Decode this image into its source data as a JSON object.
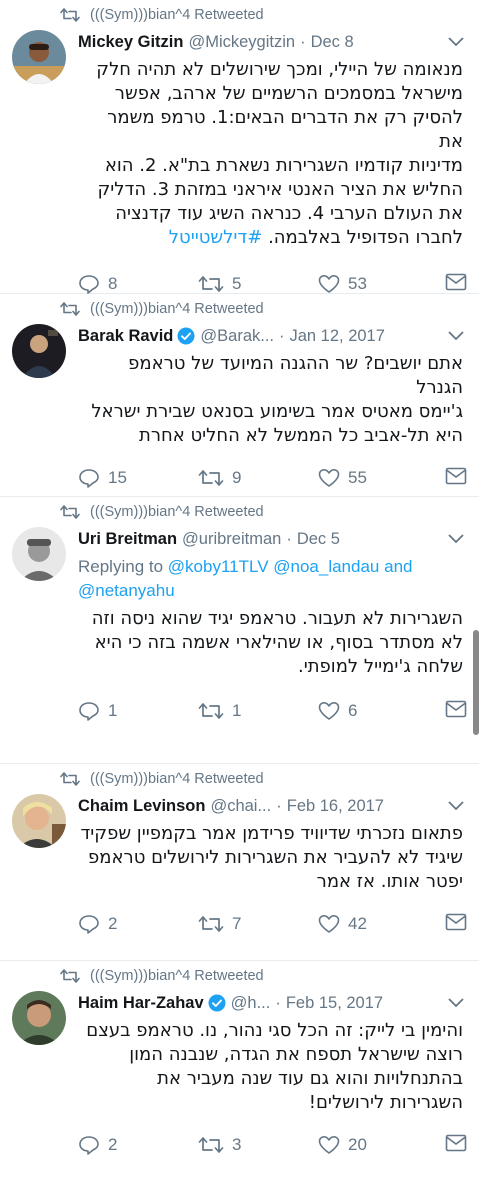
{
  "retweet_label": "(((Sym)))bian^4 Retweeted",
  "tweets": [
    {
      "name": "Mickey Gitzin",
      "handle": "@Mickeygitzin",
      "date": "Dec 8",
      "verified": false,
      "text_lines": [
        "מנאומה של היילי, ומכך שירושלים לא תהיה חלק",
        "מישראל במסמכים הרשמיים של ארהב, אפשר",
        "להסיק רק את הדברים הבאים:1. טרמפ משמר את",
        "מדיניות קודמיו השגרירות נשארת בת\"א. 2. הוא",
        "החליש את הציר האנטי איראני במזהת 3. הדליק",
        "את העולם הערבי 4. כנראה השיג עוד קדנציה"
      ],
      "last_line_text": "לחברו הפדופיל באלבמה.",
      "hashtag": "#דילשטייטל",
      "replies": "8",
      "retweets": "5",
      "likes": "53"
    },
    {
      "name": "Barak Ravid",
      "handle": "@Barak...",
      "date": "Jan 12, 2017",
      "verified": true,
      "text_lines": [
        "אתם יושבים? שר ההגנה המיועד של טראמפ הגנרל",
        "ג'יימס מאטיס אמר בשימוע בסנאט שבירת ישראל",
        "היא תל-אביב כל הממשל לא החליט אחרת"
      ],
      "replies": "15",
      "retweets": "9",
      "likes": "55"
    },
    {
      "name": "Uri Breitman",
      "handle": "@uribreitman",
      "date": "Dec 5",
      "verified": false,
      "replying_label": "Replying to",
      "replying_users": "@koby11TLV @noa_landau",
      "replying_and": "and",
      "replying_last": "@netanyahu",
      "text_lines": [
        "השגרירות לא תעבור. טראמפ יגיד שהוא ניסה וזה",
        "לא מסתדר בסוף, או שהילארי אשמה בזה כי היא",
        "שלחה ג'ימייל למופתי."
      ],
      "replies": "1",
      "retweets": "1",
      "likes": "6"
    },
    {
      "name": "Chaim Levinson",
      "handle": "@chai...",
      "date": "Feb 16, 2017",
      "verified": false,
      "text_lines": [
        "פתאום נזכרתי שדיוויד פרידמן אמר בקמפיין שפקיד",
        "שיגיד לא להעביר את השגרירות לירושלים טראמפ",
        "יפטר אותו. אז אמר"
      ],
      "replies": "2",
      "retweets": "7",
      "likes": "42"
    },
    {
      "name": "Haim Har-Zahav",
      "handle": "@h...",
      "date": "Feb 15, 2017",
      "verified": true,
      "text_lines": [
        "והימין בי לייק: זה הכל סגי נהור, נו. טראמפ בעצם",
        "רוצה שישראל תספח את הגדה, שנבנה המון",
        "בהתנחלויות והוא גם עוד שנה מעביר את",
        "השגרירות לירושלים!"
      ],
      "replies": "2",
      "retweets": "3",
      "likes": "20"
    }
  ],
  "colors": {
    "text": "#14171a",
    "secondary": "#657786",
    "link": "#1da1f2",
    "divider": "#e6ecf0",
    "verified": "#1da1f2"
  },
  "icons": [
    "retweet-icon",
    "chevron-down-icon",
    "reply-icon",
    "like-icon",
    "direct-message-icon",
    "verified-badge-icon"
  ]
}
